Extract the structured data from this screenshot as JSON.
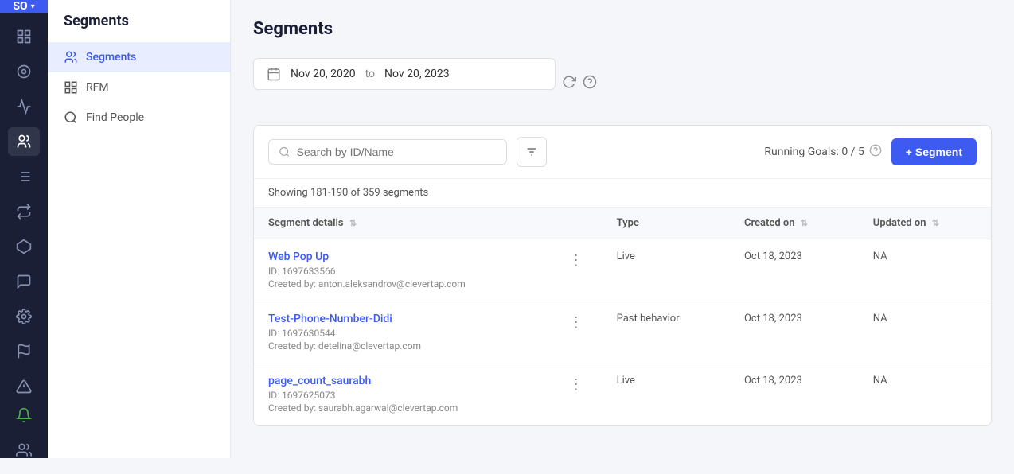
{
  "iconbar": {
    "avatar": "SO",
    "chevron": "▾",
    "icons": [
      {
        "name": "dashboard-icon",
        "symbol": "⊞"
      },
      {
        "name": "campaigns-icon",
        "symbol": "◎"
      },
      {
        "name": "analytics-icon",
        "symbol": "📊"
      },
      {
        "name": "segments-icon",
        "symbol": "👥"
      },
      {
        "name": "funnels-icon",
        "symbol": "⬦"
      },
      {
        "name": "journeys-icon",
        "symbol": "↪"
      },
      {
        "name": "connectors-icon",
        "symbol": "⬡"
      },
      {
        "name": "support-icon",
        "symbol": "💬"
      },
      {
        "name": "settings-icon",
        "symbol": "⚙"
      },
      {
        "name": "flags-icon",
        "symbol": "⚑"
      },
      {
        "name": "alerts-icon",
        "symbol": "⚠"
      },
      {
        "name": "bell-icon",
        "symbol": "🔔"
      },
      {
        "name": "team-icon",
        "symbol": "👤"
      }
    ]
  },
  "sidebar": {
    "title": "Segments",
    "items": [
      {
        "label": "Segments",
        "active": true
      },
      {
        "label": "RFM",
        "active": false
      },
      {
        "label": "Find People",
        "active": false
      }
    ]
  },
  "page": {
    "title": "Segments",
    "date_from": "Nov 20, 2020",
    "date_to": "Nov 20, 2023",
    "date_separator": "to",
    "search_placeholder": "Search by ID/Name",
    "running_goals": "Running Goals: 0 / 5",
    "add_segment_btn": "+ Segment",
    "showing_text": "Showing 181-190 of 359 segments",
    "table": {
      "headers": [
        {
          "label": "Segment details",
          "sortable": true
        },
        {
          "label": "Type",
          "sortable": false
        },
        {
          "label": "Created on",
          "sortable": true
        },
        {
          "label": "Updated on",
          "sortable": true
        }
      ],
      "rows": [
        {
          "name": "Web Pop Up",
          "id": "ID: 1697633566",
          "created_by": "Created by: anton.aleksandrov@clevertap.com",
          "type": "Live",
          "created_on": "Oct 18, 2023",
          "updated_on": "NA"
        },
        {
          "name": "Test-Phone-Number-Didi",
          "id": "ID: 1697630544",
          "created_by": "Created by: detelina@clevertap.com",
          "type": "Past behavior",
          "created_on": "Oct 18, 2023",
          "updated_on": "NA"
        },
        {
          "name": "page_count_saurabh",
          "id": "ID: 1697625073",
          "created_by": "Created by: saurabh.agarwal@clevertap.com",
          "type": "Live",
          "created_on": "Oct 18, 2023",
          "updated_on": "NA"
        }
      ]
    }
  }
}
